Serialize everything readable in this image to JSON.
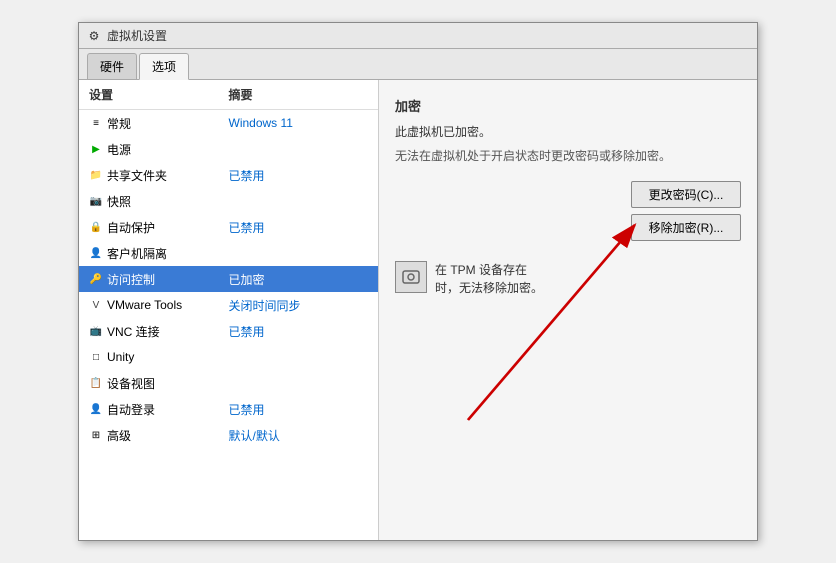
{
  "window": {
    "title": "虚拟机设置"
  },
  "tabs": [
    {
      "id": "hardware",
      "label": "硬件"
    },
    {
      "id": "options",
      "label": "选项"
    }
  ],
  "activeTab": "options",
  "listHeaders": {
    "setting": "设置",
    "summary": "摘要"
  },
  "listItems": [
    {
      "id": "general",
      "icon": "☰",
      "name": "常规",
      "summary": "Windows 11",
      "summaryColor": "#0066cc"
    },
    {
      "id": "power",
      "icon": "▶",
      "name": "电源",
      "summary": "",
      "iconColor": "#00aa00"
    },
    {
      "id": "shared-folders",
      "icon": "📁",
      "name": "共享文件夹",
      "summary": "已禁用"
    },
    {
      "id": "snapshot",
      "icon": "📷",
      "name": "快照",
      "summary": ""
    },
    {
      "id": "auto-protect",
      "icon": "🔒",
      "name": "自动保护",
      "summary": "已禁用"
    },
    {
      "id": "guest-isolation",
      "icon": "👤",
      "name": "客户机隔离",
      "summary": ""
    },
    {
      "id": "access-control",
      "icon": "🔑",
      "name": "访问控制",
      "summary": "已加密",
      "selected": true
    },
    {
      "id": "vmware-tools",
      "icon": "V",
      "name": "VMware Tools",
      "summary": "关闭时间同步"
    },
    {
      "id": "vnc",
      "icon": "📺",
      "name": "VNC 连接",
      "summary": "已禁用"
    },
    {
      "id": "unity",
      "icon": "□",
      "name": "Unity",
      "summary": ""
    },
    {
      "id": "device-view",
      "icon": "💻",
      "name": "设备视图",
      "summary": ""
    },
    {
      "id": "auto-login",
      "icon": "👤",
      "name": "自动登录",
      "summary": "已禁用"
    },
    {
      "id": "advanced",
      "icon": "⊞",
      "name": "高级",
      "summary": "默认/默认"
    }
  ],
  "rightPanel": {
    "sectionTitle": "加密",
    "desc": "此虚拟机已加密。",
    "note": "无法在虚拟机处于开启状态时更改密码或移除加密。",
    "buttons": [
      {
        "id": "change-password",
        "label": "更改密码(C)...",
        "disabled": false
      },
      {
        "id": "remove-encryption",
        "label": "移除加密(R)...",
        "disabled": false
      }
    ],
    "tpm": {
      "text": "在 TPM 设备存在\n时，无法移除加密。"
    }
  }
}
